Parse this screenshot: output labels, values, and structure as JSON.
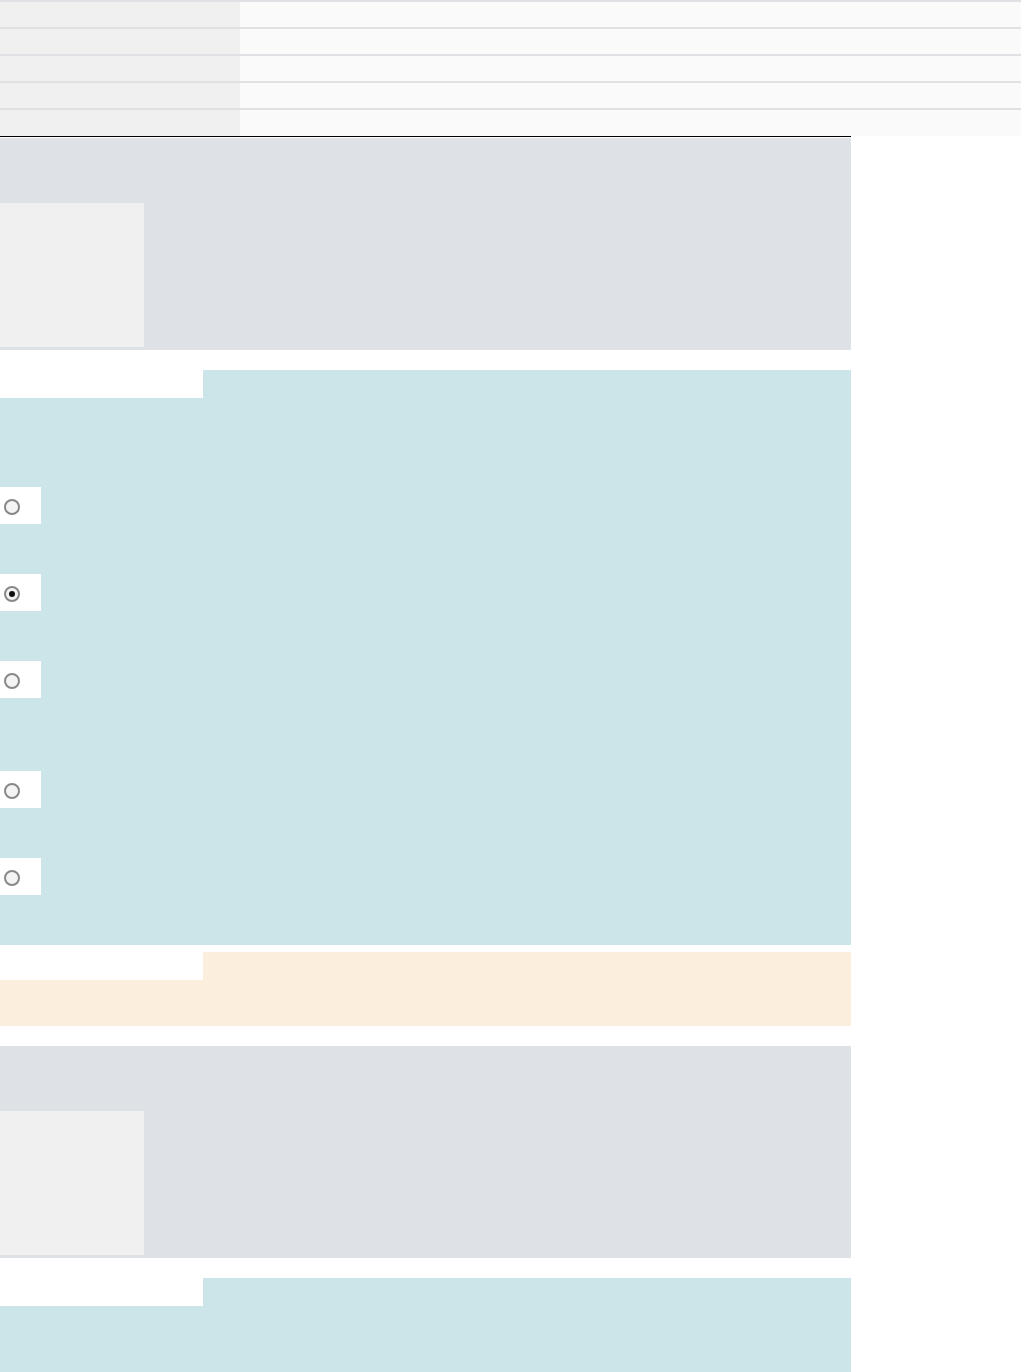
{
  "sections": [
    {
      "kind": "table"
    },
    {
      "kind": "image-card"
    },
    {
      "kind": "question",
      "options": [
        {
          "selected": false
        },
        {
          "selected": true
        },
        {
          "selected": false
        },
        {
          "selected": false
        },
        {
          "selected": false
        }
      ]
    },
    {
      "kind": "notice"
    },
    {
      "kind": "image-card"
    },
    {
      "kind": "question"
    }
  ]
}
